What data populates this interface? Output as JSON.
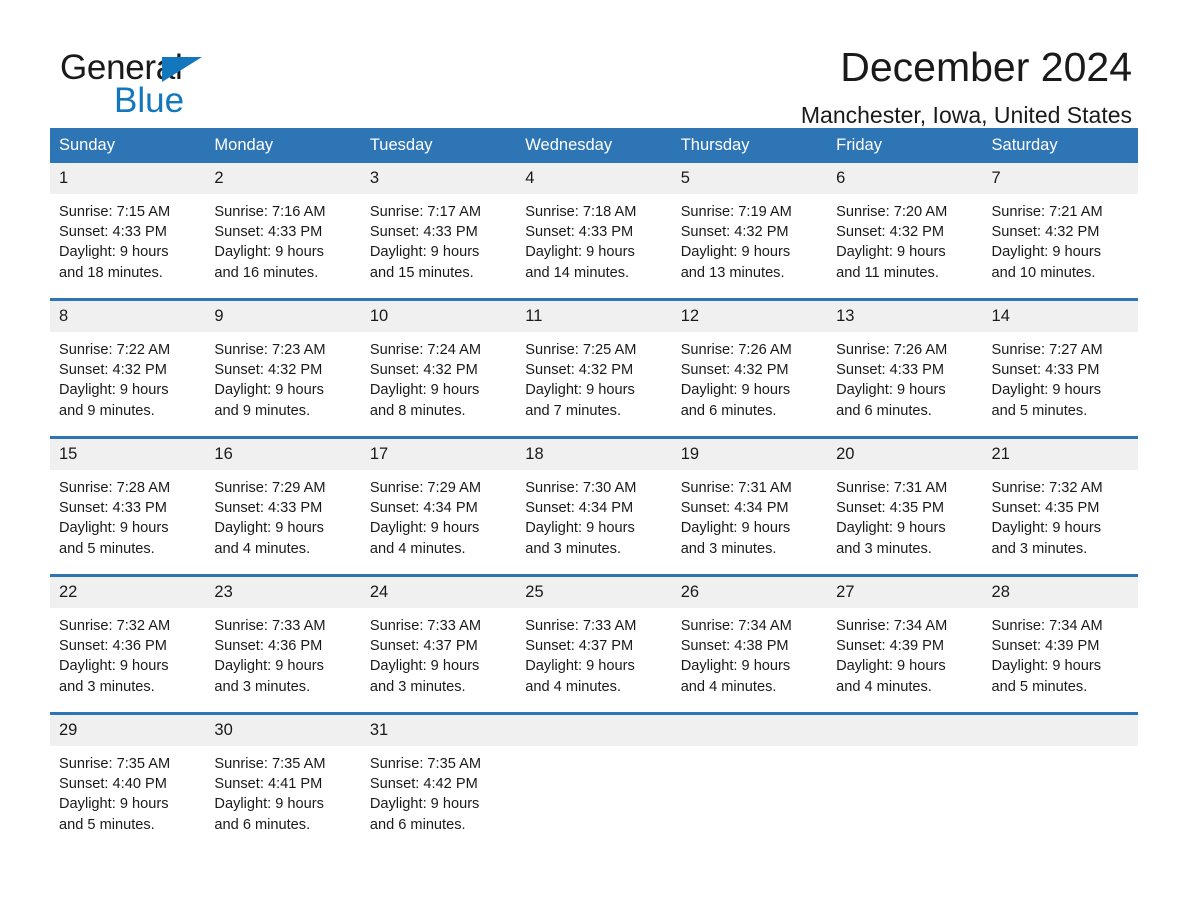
{
  "brand": {
    "name_part1": "General",
    "name_part2": "Blue",
    "triangle_color": "#1277bc",
    "icon": "triangle-logo-icon"
  },
  "header": {
    "title": "December 2024",
    "location": "Manchester, Iowa, United States",
    "accent_color": "#2e75b6"
  },
  "weekday_headers": [
    "Sunday",
    "Monday",
    "Tuesday",
    "Wednesday",
    "Thursday",
    "Friday",
    "Saturday"
  ],
  "weeks": [
    [
      {
        "day": "1",
        "sunrise": "Sunrise: 7:15 AM",
        "sunset": "Sunset: 4:33 PM",
        "daylight_line1": "Daylight: 9 hours",
        "daylight_line2": "and 18 minutes."
      },
      {
        "day": "2",
        "sunrise": "Sunrise: 7:16 AM",
        "sunset": "Sunset: 4:33 PM",
        "daylight_line1": "Daylight: 9 hours",
        "daylight_line2": "and 16 minutes."
      },
      {
        "day": "3",
        "sunrise": "Sunrise: 7:17 AM",
        "sunset": "Sunset: 4:33 PM",
        "daylight_line1": "Daylight: 9 hours",
        "daylight_line2": "and 15 minutes."
      },
      {
        "day": "4",
        "sunrise": "Sunrise: 7:18 AM",
        "sunset": "Sunset: 4:33 PM",
        "daylight_line1": "Daylight: 9 hours",
        "daylight_line2": "and 14 minutes."
      },
      {
        "day": "5",
        "sunrise": "Sunrise: 7:19 AM",
        "sunset": "Sunset: 4:32 PM",
        "daylight_line1": "Daylight: 9 hours",
        "daylight_line2": "and 13 minutes."
      },
      {
        "day": "6",
        "sunrise": "Sunrise: 7:20 AM",
        "sunset": "Sunset: 4:32 PM",
        "daylight_line1": "Daylight: 9 hours",
        "daylight_line2": "and 11 minutes."
      },
      {
        "day": "7",
        "sunrise": "Sunrise: 7:21 AM",
        "sunset": "Sunset: 4:32 PM",
        "daylight_line1": "Daylight: 9 hours",
        "daylight_line2": "and 10 minutes."
      }
    ],
    [
      {
        "day": "8",
        "sunrise": "Sunrise: 7:22 AM",
        "sunset": "Sunset: 4:32 PM",
        "daylight_line1": "Daylight: 9 hours",
        "daylight_line2": "and 9 minutes."
      },
      {
        "day": "9",
        "sunrise": "Sunrise: 7:23 AM",
        "sunset": "Sunset: 4:32 PM",
        "daylight_line1": "Daylight: 9 hours",
        "daylight_line2": "and 9 minutes."
      },
      {
        "day": "10",
        "sunrise": "Sunrise: 7:24 AM",
        "sunset": "Sunset: 4:32 PM",
        "daylight_line1": "Daylight: 9 hours",
        "daylight_line2": "and 8 minutes."
      },
      {
        "day": "11",
        "sunrise": "Sunrise: 7:25 AM",
        "sunset": "Sunset: 4:32 PM",
        "daylight_line1": "Daylight: 9 hours",
        "daylight_line2": "and 7 minutes."
      },
      {
        "day": "12",
        "sunrise": "Sunrise: 7:26 AM",
        "sunset": "Sunset: 4:32 PM",
        "daylight_line1": "Daylight: 9 hours",
        "daylight_line2": "and 6 minutes."
      },
      {
        "day": "13",
        "sunrise": "Sunrise: 7:26 AM",
        "sunset": "Sunset: 4:33 PM",
        "daylight_line1": "Daylight: 9 hours",
        "daylight_line2": "and 6 minutes."
      },
      {
        "day": "14",
        "sunrise": "Sunrise: 7:27 AM",
        "sunset": "Sunset: 4:33 PM",
        "daylight_line1": "Daylight: 9 hours",
        "daylight_line2": "and 5 minutes."
      }
    ],
    [
      {
        "day": "15",
        "sunrise": "Sunrise: 7:28 AM",
        "sunset": "Sunset: 4:33 PM",
        "daylight_line1": "Daylight: 9 hours",
        "daylight_line2": "and 5 minutes."
      },
      {
        "day": "16",
        "sunrise": "Sunrise: 7:29 AM",
        "sunset": "Sunset: 4:33 PM",
        "daylight_line1": "Daylight: 9 hours",
        "daylight_line2": "and 4 minutes."
      },
      {
        "day": "17",
        "sunrise": "Sunrise: 7:29 AM",
        "sunset": "Sunset: 4:34 PM",
        "daylight_line1": "Daylight: 9 hours",
        "daylight_line2": "and 4 minutes."
      },
      {
        "day": "18",
        "sunrise": "Sunrise: 7:30 AM",
        "sunset": "Sunset: 4:34 PM",
        "daylight_line1": "Daylight: 9 hours",
        "daylight_line2": "and 3 minutes."
      },
      {
        "day": "19",
        "sunrise": "Sunrise: 7:31 AM",
        "sunset": "Sunset: 4:34 PM",
        "daylight_line1": "Daylight: 9 hours",
        "daylight_line2": "and 3 minutes."
      },
      {
        "day": "20",
        "sunrise": "Sunrise: 7:31 AM",
        "sunset": "Sunset: 4:35 PM",
        "daylight_line1": "Daylight: 9 hours",
        "daylight_line2": "and 3 minutes."
      },
      {
        "day": "21",
        "sunrise": "Sunrise: 7:32 AM",
        "sunset": "Sunset: 4:35 PM",
        "daylight_line1": "Daylight: 9 hours",
        "daylight_line2": "and 3 minutes."
      }
    ],
    [
      {
        "day": "22",
        "sunrise": "Sunrise: 7:32 AM",
        "sunset": "Sunset: 4:36 PM",
        "daylight_line1": "Daylight: 9 hours",
        "daylight_line2": "and 3 minutes."
      },
      {
        "day": "23",
        "sunrise": "Sunrise: 7:33 AM",
        "sunset": "Sunset: 4:36 PM",
        "daylight_line1": "Daylight: 9 hours",
        "daylight_line2": "and 3 minutes."
      },
      {
        "day": "24",
        "sunrise": "Sunrise: 7:33 AM",
        "sunset": "Sunset: 4:37 PM",
        "daylight_line1": "Daylight: 9 hours",
        "daylight_line2": "and 3 minutes."
      },
      {
        "day": "25",
        "sunrise": "Sunrise: 7:33 AM",
        "sunset": "Sunset: 4:37 PM",
        "daylight_line1": "Daylight: 9 hours",
        "daylight_line2": "and 4 minutes."
      },
      {
        "day": "26",
        "sunrise": "Sunrise: 7:34 AM",
        "sunset": "Sunset: 4:38 PM",
        "daylight_line1": "Daylight: 9 hours",
        "daylight_line2": "and 4 minutes."
      },
      {
        "day": "27",
        "sunrise": "Sunrise: 7:34 AM",
        "sunset": "Sunset: 4:39 PM",
        "daylight_line1": "Daylight: 9 hours",
        "daylight_line2": "and 4 minutes."
      },
      {
        "day": "28",
        "sunrise": "Sunrise: 7:34 AM",
        "sunset": "Sunset: 4:39 PM",
        "daylight_line1": "Daylight: 9 hours",
        "daylight_line2": "and 5 minutes."
      }
    ],
    [
      {
        "day": "29",
        "sunrise": "Sunrise: 7:35 AM",
        "sunset": "Sunset: 4:40 PM",
        "daylight_line1": "Daylight: 9 hours",
        "daylight_line2": "and 5 minutes."
      },
      {
        "day": "30",
        "sunrise": "Sunrise: 7:35 AM",
        "sunset": "Sunset: 4:41 PM",
        "daylight_line1": "Daylight: 9 hours",
        "daylight_line2": "and 6 minutes."
      },
      {
        "day": "31",
        "sunrise": "Sunrise: 7:35 AM",
        "sunset": "Sunset: 4:42 PM",
        "daylight_line1": "Daylight: 9 hours",
        "daylight_line2": "and 6 minutes."
      },
      {
        "day": "",
        "sunrise": "",
        "sunset": "",
        "daylight_line1": "",
        "daylight_line2": ""
      },
      {
        "day": "",
        "sunrise": "",
        "sunset": "",
        "daylight_line1": "",
        "daylight_line2": ""
      },
      {
        "day": "",
        "sunrise": "",
        "sunset": "",
        "daylight_line1": "",
        "daylight_line2": ""
      },
      {
        "day": "",
        "sunrise": "",
        "sunset": "",
        "daylight_line1": "",
        "daylight_line2": ""
      }
    ]
  ]
}
